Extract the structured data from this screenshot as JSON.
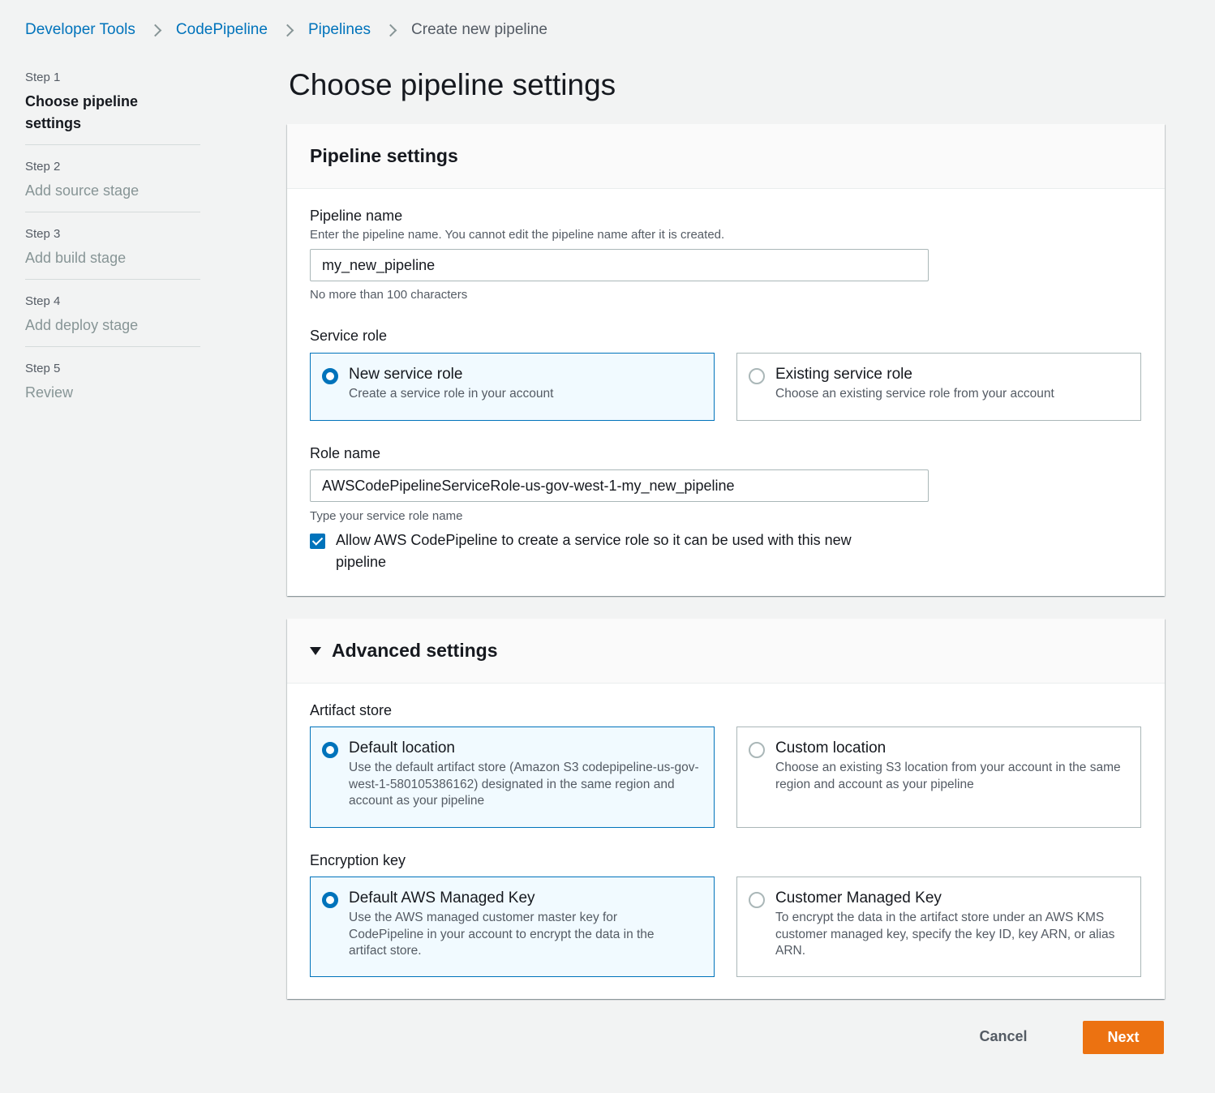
{
  "breadcrumb": {
    "items": [
      "Developer Tools",
      "CodePipeline",
      "Pipelines"
    ],
    "current": "Create new pipeline"
  },
  "steps": [
    {
      "num": "Step 1",
      "title": "Choose pipeline settings",
      "active": true
    },
    {
      "num": "Step 2",
      "title": "Add source stage"
    },
    {
      "num": "Step 3",
      "title": "Add build stage"
    },
    {
      "num": "Step 4",
      "title": "Add deploy stage"
    },
    {
      "num": "Step 5",
      "title": "Review"
    }
  ],
  "page_title": "Choose pipeline settings",
  "pipeline_settings": {
    "header": "Pipeline settings",
    "name_label": "Pipeline name",
    "name_description": "Enter the pipeline name. You cannot edit the pipeline name after it is created.",
    "name_value": "my_new_pipeline",
    "name_constraint": "No more than 100 characters",
    "service_role_label": "Service role",
    "service_role_options": [
      {
        "title": "New service role",
        "desc": "Create a service role in your account",
        "selected": true
      },
      {
        "title": "Existing service role",
        "desc": "Choose an existing service role from your account",
        "selected": false
      }
    ],
    "role_name_label": "Role name",
    "role_name_value": "AWSCodePipelineServiceRole-us-gov-west-1-my_new_pipeline",
    "role_name_constraint": "Type your service role name",
    "allow_checkbox_label": "Allow AWS CodePipeline to create a service role so it can be used with this new pipeline",
    "allow_checked": true
  },
  "advanced_settings": {
    "header": "Advanced settings",
    "artifact_store_label": "Artifact store",
    "artifact_options": [
      {
        "title": "Default location",
        "desc": "Use the default artifact store (Amazon S3 codepipeline-us-gov-west-1-580105386162) designated in the same region and account as your pipeline",
        "selected": true
      },
      {
        "title": "Custom location",
        "desc": "Choose an existing S3 location from your account in the same region and account as your pipeline",
        "selected": false
      }
    ],
    "encryption_key_label": "Encryption key",
    "encryption_options": [
      {
        "title": "Default AWS Managed Key",
        "desc": "Use the AWS managed customer master key for CodePipeline in your account to encrypt the data in the artifact store.",
        "selected": true
      },
      {
        "title": "Customer Managed Key",
        "desc": "To encrypt the data in the artifact store under an AWS KMS customer managed key, specify the key ID, key ARN, or alias ARN.",
        "selected": false
      }
    ]
  },
  "actions": {
    "cancel_label": "Cancel",
    "next_label": "Next"
  },
  "colors": {
    "accent": "#0073bb",
    "primary_button": "#ec7211",
    "background": "#f2f3f3"
  }
}
